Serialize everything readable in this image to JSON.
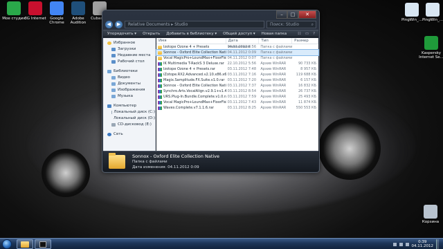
{
  "desktop_icons_left": [
    {
      "label": "Мое студия",
      "color": "#2aa84a"
    },
    {
      "label": "3G Internet",
      "color": "#c8102e"
    },
    {
      "label": "Google Chrome",
      "color": "#4285f4"
    },
    {
      "label": "Adobe Audition",
      "color": "#1f4f7a"
    },
    {
      "label": "Cubase 5",
      "color": "#a0a0a0"
    }
  ],
  "desktop_icons_right": [
    {
      "label": "PingWin_...",
      "color": "#d8e6f2"
    },
    {
      "label": "PingWin_...",
      "color": "#d8e6f2"
    },
    {
      "label": "Kaspersky Internet Se...",
      "color": "#1f9a3a"
    },
    {
      "label": "Корзина",
      "color": "#b8c3cf"
    }
  ],
  "window": {
    "address": "Relative Documents ▸ Studio",
    "search_placeholder": "Поиск: Studio",
    "toolbar": {
      "organize": "Упорядочить ▾",
      "open": "Открыть",
      "add_library": "Добавить в библиотеку ▾",
      "share": "Общий доступ ▾",
      "new_folder": "Новая папка"
    },
    "sidebar": {
      "favorites": {
        "header": "Избранное",
        "items": [
          "Загрузки",
          "Недавние места",
          "Рабочий стол"
        ]
      },
      "libraries": {
        "header": "Библиотеки",
        "items": [
          "Видео",
          "Документы",
          "Изображения",
          "Музыка"
        ]
      },
      "computer": {
        "header": "Компьютер",
        "items": [
          "Локальный диск (C:)",
          "Локальный диск (D:)",
          "CD-дисковод (E:)"
        ]
      },
      "network": {
        "header": "Сеть"
      }
    },
    "columns": {
      "name": "Имя",
      "date": "Дата изменения",
      "type": "Тип",
      "size": "Размер"
    },
    "files": [
      {
        "name": "Izotope Ozone 4 + Presets",
        "date": "04.11.2012 8:56",
        "type": "Папка с файлами",
        "size": "",
        "icon": "folder"
      },
      {
        "name": "Sonnox - Oxford Elite Collection Native",
        "date": "04.11.2012 0:09",
        "type": "Папка с файлами",
        "size": "",
        "icon": "folder"
      },
      {
        "name": "Vocal MagicPro+LoundMax+FloorFish",
        "date": "04.11.2012 0:07",
        "type": "Папка с файлами",
        "size": "",
        "icon": "folder"
      },
      {
        "name": "IK Multimedia T-RackS 3 Deluxe.rar",
        "date": "22.10.2012 5:56",
        "type": "Архив WinRAR",
        "size": "90 733 КБ",
        "icon": "rar"
      },
      {
        "name": "Izotope Ozone 4 + Presets.rar",
        "date": "03.11.2012 7:48",
        "type": "Архив WinRAR",
        "size": "8 957 КБ",
        "icon": "rar"
      },
      {
        "name": "iZotope.RX2.Advanced.v2.10.x86.x64.rar",
        "date": "03.11.2012 7:16",
        "type": "Архив WinRAR",
        "size": "119 688 КБ",
        "icon": "rar"
      },
      {
        "name": "Magix.Samplitude.FX.Suite.v1.0.rar",
        "date": "03.11.2012 7:20",
        "type": "Архив WinRAR",
        "size": "6 157 КБ",
        "icon": "rar"
      },
      {
        "name": "Sonnox - Oxford Elite Collection Native.rar",
        "date": "03.11.2012 7:37",
        "type": "Архив WinRAR",
        "size": "16 832 КБ",
        "icon": "rar"
      },
      {
        "name": "Synchro.Arts.VocalAlign.v2.9.1+v1.4.rar",
        "date": "03.11.2012 8:54",
        "type": "Архив WinRAR",
        "size": "26 737 КБ",
        "icon": "rar"
      },
      {
        "name": "URS.Plug-In.Bundle.Complete.v1.0.rar",
        "date": "03.11.2012 7:59",
        "type": "Архив WinRAR",
        "size": "25 493 КБ",
        "icon": "rar"
      },
      {
        "name": "Vocal MagicPro+LoundMax+FloorFish.rar",
        "date": "03.11.2012 7:43",
        "type": "Архив WinRAR",
        "size": "11 874 КБ",
        "icon": "rar"
      },
      {
        "name": "Waves.Complete.v7.1.1.6.rar",
        "date": "03.11.2012 8:25",
        "type": "Архив WinRAR",
        "size": "550 553 КБ",
        "icon": "rar"
      }
    ],
    "details": {
      "name": "Sonnox - Oxford Elite Collection Native",
      "type": "Папка с файлами",
      "modified": "Дата изменения: 04.11.2012 0:09"
    }
  },
  "taskbar": {
    "time": "0:39",
    "date": "04.11.2012"
  }
}
